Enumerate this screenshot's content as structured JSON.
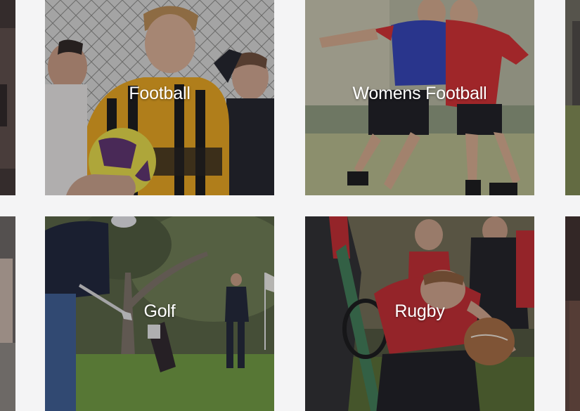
{
  "tiles": [
    {
      "id": "football",
      "label": "Football"
    },
    {
      "id": "womens-football",
      "label": "Womens Football"
    },
    {
      "id": "golf",
      "label": "Golf"
    },
    {
      "id": "rugby",
      "label": "Rugby"
    }
  ],
  "colors": {
    "page_background": "#f4f4f5",
    "label_text": "#ffffff",
    "football_kit": "#e9a418",
    "womens_kit_red": "#d12a2c",
    "womens_kit_blue": "#2f3fb4",
    "golf_grass": "#6e9a3c",
    "rugby_kit_red": "#c2272b"
  }
}
